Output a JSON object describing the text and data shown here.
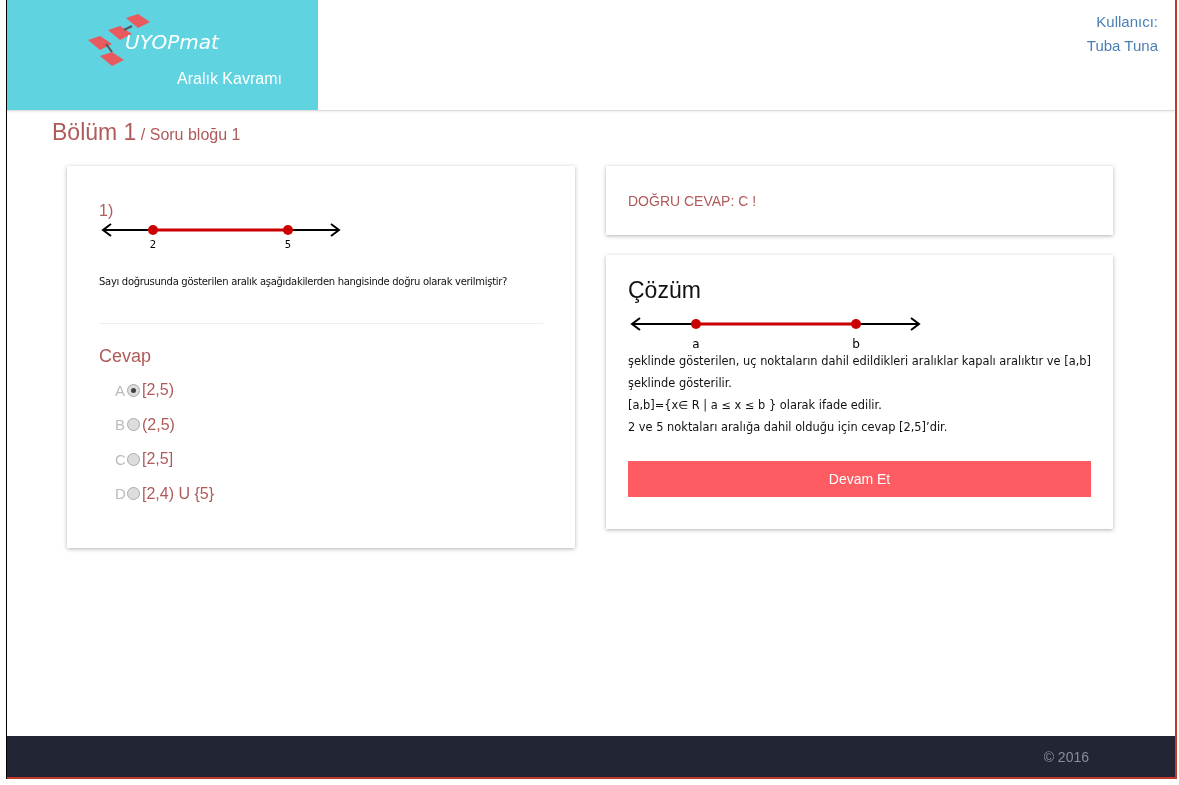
{
  "header": {
    "logo_text": "UYOPmat",
    "subtitle": "Aralık Kavramı",
    "user_label": "Kullanıcı:",
    "user_name": "Tuba Tuna"
  },
  "breadcrumb": {
    "section": "Bölüm 1",
    "block": "/ Soru bloğu 1"
  },
  "question": {
    "number": "1)",
    "line_labels": [
      "2",
      "5"
    ],
    "text": "Sayı doğrusunda gösterilen aralık aşağıdakilerden hangisinde doğru olarak verilmiştir?",
    "answer_heading": "Cevap",
    "options": [
      {
        "letter": "A",
        "text": "[2,5)",
        "selected": true
      },
      {
        "letter": "B",
        "text": "(2,5)",
        "selected": false
      },
      {
        "letter": "C",
        "text": "[2,5]",
        "selected": false
      },
      {
        "letter": "D",
        "text": "[2,4) U {5}",
        "selected": false
      }
    ]
  },
  "result": {
    "text": "DOĞRU CEVAP: C !"
  },
  "solution": {
    "title": "Çözüm",
    "line_labels": [
      "a",
      "b"
    ],
    "paragraphs": [
      "şeklinde gösterilen, uç noktaların dahil edildikleri aralıklar kapalı aralıktır ve [a,b] şeklinde gösterilir.",
      "[a,b]={x∈ R | a ≤  x ≤ b } olarak ifade edilir.",
      "2 ve 5 noktaları aralığa dahil olduğu için cevap [2,5]’dir."
    ],
    "button": "Devam Et"
  },
  "footer": {
    "copyright": "© 2016"
  }
}
